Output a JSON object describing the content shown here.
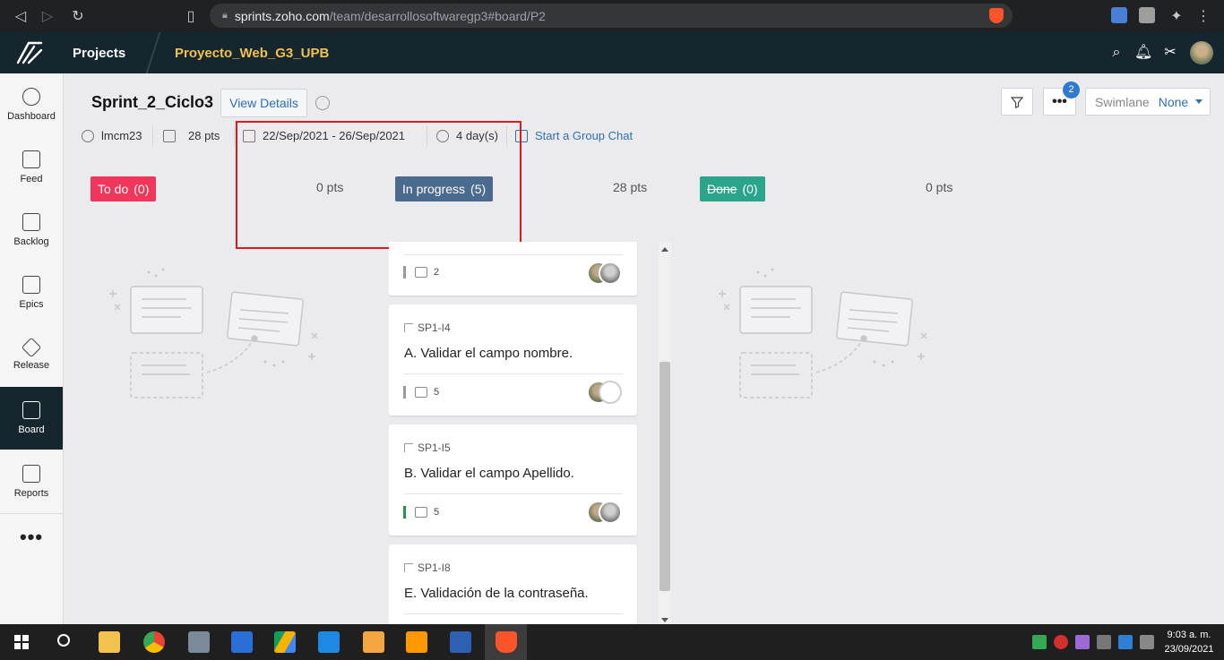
{
  "browser": {
    "url_host": "sprints.zoho.com",
    "url_path": "/team/desarrollosoftwaregp3#board/P2"
  },
  "header": {
    "projects_label": "Projects",
    "project_name": "Proyecto_Web_G3_UPB"
  },
  "sidebar": {
    "items": [
      {
        "label": "Dashboard",
        "icon": "gauge-icon"
      },
      {
        "label": "Feed",
        "icon": "feed-icon"
      },
      {
        "label": "Backlog",
        "icon": "backlog-icon"
      },
      {
        "label": "Epics",
        "icon": "epics-icon"
      },
      {
        "label": "Release",
        "icon": "paper-plane-icon"
      },
      {
        "label": "Board",
        "icon": "board-icon"
      },
      {
        "label": "Reports",
        "icon": "reports-icon"
      }
    ],
    "more": "•••"
  },
  "sprint": {
    "title": "Sprint_2_Ciclo3",
    "view_details": "View Details",
    "owner": "lmcm23",
    "points": "28 pts",
    "dates": "22/Sep/2021 - 26/Sep/2021",
    "duration": "4 day(s)",
    "group_chat": "Start a Group Chat"
  },
  "toolbar": {
    "more_label": "•••",
    "notification_count": "2",
    "swimlane_label": "Swimlane",
    "swimlane_value": "None"
  },
  "columns": [
    {
      "name": "To do",
      "count": "(0)",
      "points": "0 pts",
      "color": "#f0365a"
    },
    {
      "name": "In progress",
      "count": "(5)",
      "points": "28 pts",
      "color": "#4a6b8d"
    },
    {
      "name": "Done",
      "count": "(0)",
      "points": "0 pts",
      "color": "#2aa58b"
    }
  ],
  "cards": [
    {
      "id": "",
      "title": "",
      "points": "2"
    },
    {
      "id": "SP1-I4",
      "title": "A. Validar el campo nombre.",
      "points": "5"
    },
    {
      "id": "SP1-I5",
      "title": "B. Validar el campo Apellido.",
      "points": "5"
    },
    {
      "id": "SP1-I8",
      "title": "E. Validación de la contraseña.",
      "points": ""
    }
  ],
  "taskbar": {
    "time": "9:03 a. m.",
    "date": "23/09/2021"
  }
}
